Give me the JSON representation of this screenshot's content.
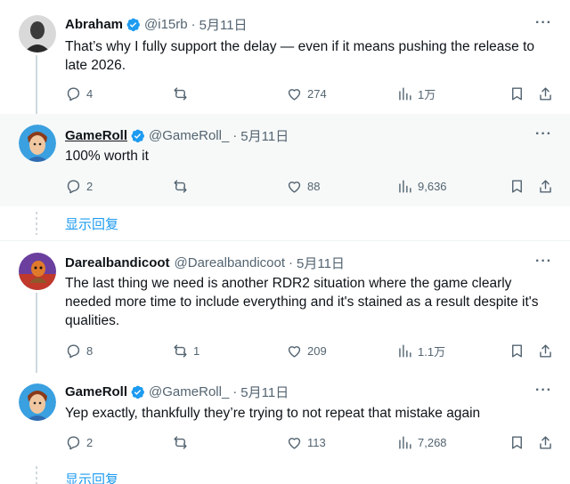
{
  "tweets": [
    {
      "name": "Abraham",
      "handle": "@i15rb",
      "dot": "·",
      "date": "5月11日",
      "more": "···",
      "text": "That’s why I fully support the delay — even if it means pushing the release to late 2026.",
      "replies": "4",
      "retweets": "",
      "likes": "274",
      "views": "1万"
    },
    {
      "name": "GameRoll",
      "handle": "@GameRoll_",
      "dot": "·",
      "date": "5月11日",
      "more": "···",
      "text": "100% worth it",
      "replies": "2",
      "retweets": "",
      "likes": "88",
      "views": "9,636"
    },
    {
      "name": "Darealbandicoot",
      "handle": "@Darealbandicoot",
      "dot": "·",
      "date": "5月11日",
      "more": "···",
      "text": "The last thing we need is another RDR2 situation where the game clearly needed more time to include everything and it's stained as a result despite it's qualities.",
      "replies": "8",
      "retweets": "1",
      "likes": "209",
      "views": "1.1万"
    },
    {
      "name": "GameRoll",
      "handle": "@GameRoll_",
      "dot": "·",
      "date": "5月11日",
      "more": "···",
      "text": "Yep exactly, thankfully they’re trying to not repeat that mistake again",
      "replies": "2",
      "retweets": "",
      "likes": "113",
      "views": "7,268"
    }
  ],
  "show_replies": "显示回复",
  "colors": {
    "accent": "#1d9bf0",
    "secondary_text": "#536471",
    "highlight_bg": "#f7f9f9"
  }
}
